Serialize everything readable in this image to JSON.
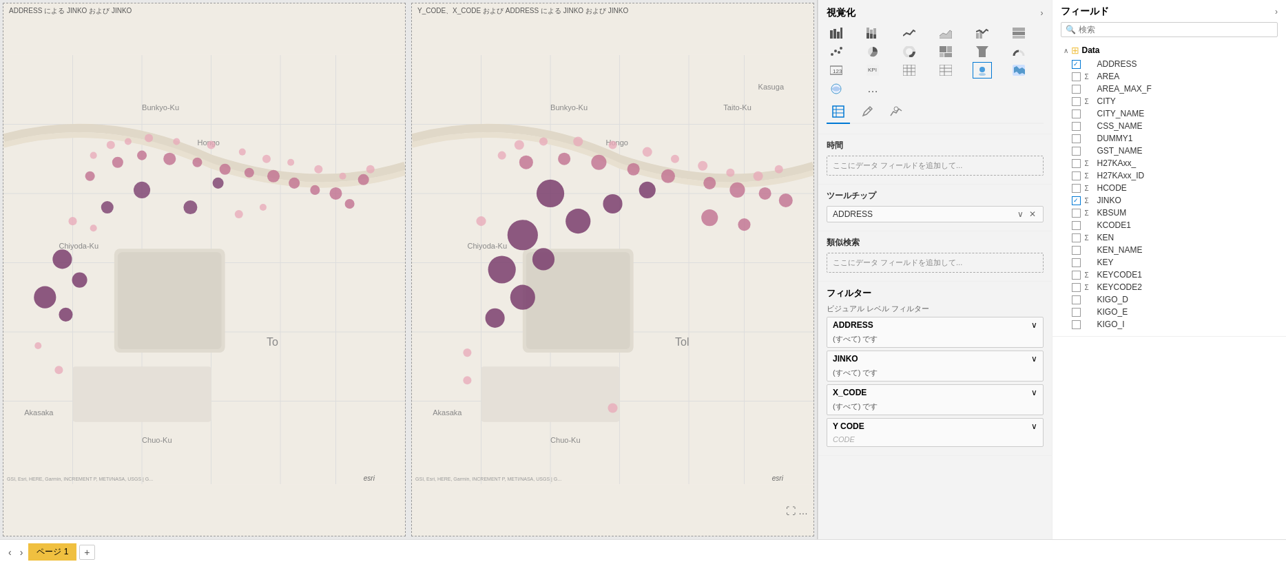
{
  "maps": [
    {
      "id": "map1",
      "title": "ADDRESS による JINKO および JINKO"
    },
    {
      "id": "map2",
      "title": "Y_CODE、X_CODE および ADDRESS による JINKO および JINKO"
    }
  ],
  "visualization": {
    "panel_title": "視覚化",
    "chevron": "›",
    "icons": [
      {
        "id": "bar-chart",
        "symbol": "▬",
        "active": false
      },
      {
        "id": "column-chart",
        "symbol": "📊",
        "active": false
      },
      {
        "id": "line-chart",
        "symbol": "📈",
        "active": false
      },
      {
        "id": "area-chart",
        "symbol": "~",
        "active": false
      },
      {
        "id": "combo-chart",
        "symbol": "⊞",
        "active": false
      },
      {
        "id": "bar2-chart",
        "symbol": "≡",
        "active": false
      },
      {
        "id": "scatter",
        "symbol": "⋮",
        "active": false
      },
      {
        "id": "pie",
        "symbol": "◕",
        "active": false
      },
      {
        "id": "donut",
        "symbol": "◎",
        "active": false
      },
      {
        "id": "treemap",
        "symbol": "▦",
        "active": false
      },
      {
        "id": "funnel",
        "symbol": "⊽",
        "active": false
      },
      {
        "id": "gauge",
        "symbol": "◑",
        "active": false
      },
      {
        "id": "card",
        "symbol": "▭",
        "active": false
      },
      {
        "id": "kpi",
        "symbol": "▤",
        "active": false
      },
      {
        "id": "table",
        "symbol": "⊟",
        "active": false
      },
      {
        "id": "matrix",
        "symbol": "⊞",
        "active": false
      },
      {
        "id": "map",
        "symbol": "🗺",
        "active": true
      },
      {
        "id": "filled-map",
        "symbol": "⬛",
        "active": false
      },
      {
        "id": "azure-map",
        "symbol": "🌐",
        "active": false
      },
      {
        "id": "more",
        "symbol": "…",
        "active": false
      }
    ],
    "format_tabs": [
      {
        "id": "fields",
        "icon": "⊞",
        "label": "フィールド",
        "active": true
      },
      {
        "id": "format",
        "icon": "🎨",
        "label": "書式設定",
        "active": false
      },
      {
        "id": "analytics",
        "icon": "📊",
        "label": "分析",
        "active": false
      }
    ]
  },
  "config": {
    "time_label": "時間",
    "time_placeholder": "ここにデータ フィールドを追加して...",
    "tooltip_label": "ツールチップ",
    "tooltip_value": "ADDRESS",
    "similarity_label": "類似検索",
    "similarity_placeholder": "ここにデータ フィールドを追加して..."
  },
  "filters": {
    "title": "フィルター",
    "visual_level_title": "ビジュアル レベル フィルター",
    "items": [
      {
        "label": "ADDRESS",
        "sub": "(すべて) です"
      },
      {
        "label": "JINKO",
        "sub": "(すべて) です"
      },
      {
        "label": "X_CODE",
        "sub": "(すべて) です"
      },
      {
        "label": "Y CODE",
        "sub": ""
      }
    ]
  },
  "fields": {
    "panel_title": "フィールド",
    "chevron": "›",
    "search_placeholder": "検索",
    "data_table": "Data",
    "items": [
      {
        "name": "ADDRESS",
        "checked": true,
        "sigma": false
      },
      {
        "name": "AREA",
        "checked": false,
        "sigma": true
      },
      {
        "name": "AREA_MAX_F",
        "checked": false,
        "sigma": false
      },
      {
        "name": "CITY",
        "checked": false,
        "sigma": true
      },
      {
        "name": "CITY_NAME",
        "checked": false,
        "sigma": false
      },
      {
        "name": "CSS_NAME",
        "checked": false,
        "sigma": false
      },
      {
        "name": "DUMMY1",
        "checked": false,
        "sigma": false
      },
      {
        "name": "GST_NAME",
        "checked": false,
        "sigma": false
      },
      {
        "name": "H27KAxx_",
        "checked": false,
        "sigma": true
      },
      {
        "name": "H27KAxx_ID",
        "checked": false,
        "sigma": true
      },
      {
        "name": "HCODE",
        "checked": false,
        "sigma": true
      },
      {
        "name": "JINKO",
        "checked": true,
        "sigma": true
      },
      {
        "name": "KBSUM",
        "checked": false,
        "sigma": true
      },
      {
        "name": "KCODE1",
        "checked": false,
        "sigma": false
      },
      {
        "name": "KEN",
        "checked": false,
        "sigma": true
      },
      {
        "name": "KEN_NAME",
        "checked": false,
        "sigma": false
      },
      {
        "name": "KEY",
        "checked": false,
        "sigma": false
      },
      {
        "name": "KEYCODE1",
        "checked": false,
        "sigma": true
      },
      {
        "name": "KEYCODE2",
        "checked": false,
        "sigma": true
      },
      {
        "name": "KIGO_D",
        "checked": false,
        "sigma": false
      },
      {
        "name": "KIGO_E",
        "checked": false,
        "sigma": false
      },
      {
        "name": "KIGO_I",
        "checked": false,
        "sigma": false
      }
    ]
  },
  "bottom": {
    "page_label": "ページ 1"
  },
  "colors": {
    "accent": "#0078d4",
    "page_tab": "#f0c040",
    "dot_dark": "#7b3f6e",
    "dot_mid": "#c07090",
    "dot_light": "#e8a8b8",
    "dot_pale": "#f0c8d0"
  }
}
